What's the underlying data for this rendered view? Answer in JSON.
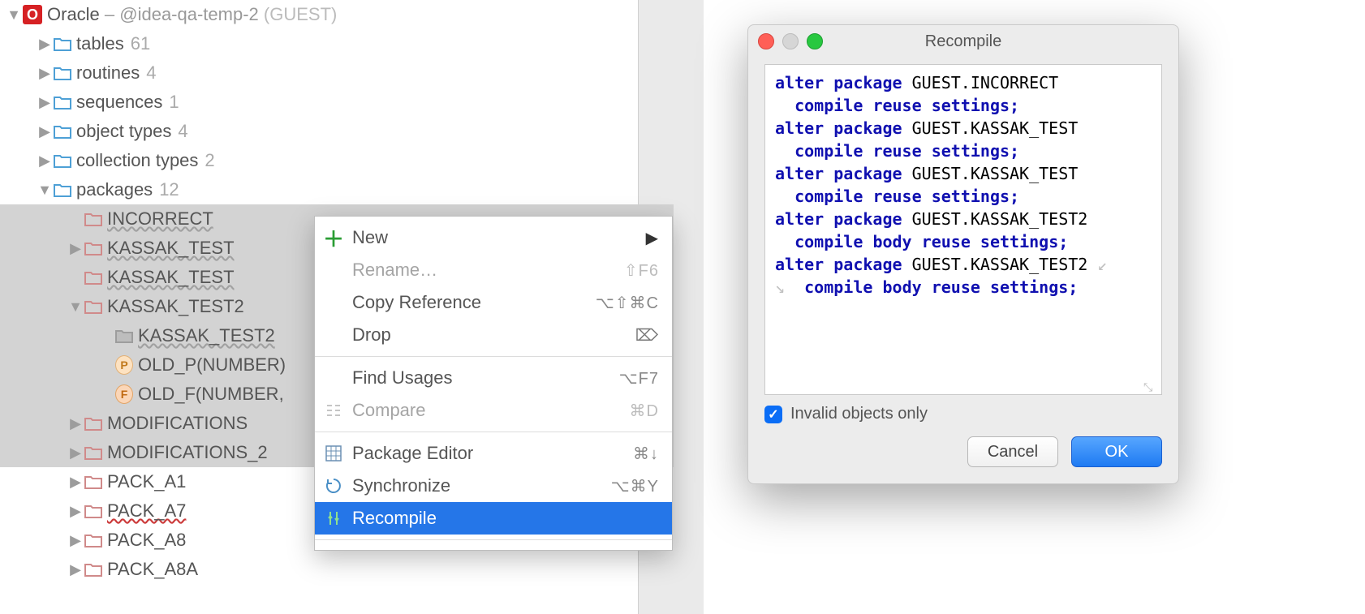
{
  "root": {
    "label": "Oracle",
    "suffix": " – @idea-qa-temp-2",
    "role": "(GUEST)"
  },
  "tree": {
    "tables": {
      "label": "tables",
      "count": "61"
    },
    "routines": {
      "label": "routines",
      "count": "4"
    },
    "sequences": {
      "label": "sequences",
      "count": "1"
    },
    "objtypes": {
      "label": "object types",
      "count": "4"
    },
    "colltypes": {
      "label": "collection types",
      "count": "2"
    },
    "packages": {
      "label": "packages",
      "count": "12"
    },
    "pkg": {
      "incorrect": "INCORRECT",
      "kassak_test": "KASSAK_TEST",
      "kassak_test_dup": "KASSAK_TEST",
      "kassak_test2": "KASSAK_TEST2",
      "kassak_test2_inner": "KASSAK_TEST2",
      "old_p": "OLD_P(NUMBER)",
      "old_f": "OLD_F(NUMBER,",
      "modifications": "MODIFICATIONS",
      "modifications2": "MODIFICATIONS_2",
      "pack_a1": "PACK_A1",
      "pack_a7": "PACK_A7",
      "pack_a8": "PACK_A8",
      "pack_a8a": "PACK_A8A"
    }
  },
  "menu": {
    "new": "New",
    "rename": "Rename…",
    "rename_sc": "⇧F6",
    "copyref": "Copy Reference",
    "copyref_sc": "⌥⇧⌘C",
    "drop": "Drop",
    "find": "Find Usages",
    "find_sc": "⌥F7",
    "compare": "Compare",
    "compare_sc": "⌘D",
    "pkgedit": "Package Editor",
    "pkgedit_sc": "⌘↓",
    "sync": "Synchronize",
    "sync_sc": "⌥⌘Y",
    "recompile": "Recompile"
  },
  "dialog": {
    "title": "Recompile",
    "checkbox": "Invalid objects only",
    "cancel": "Cancel",
    "ok": "OK",
    "sql": [
      {
        "pre": "alter package ",
        "obj": "GUEST.INCORRECT",
        "post": ""
      },
      {
        "pre": "  compile reuse settings",
        "obj": "",
        "post": ";"
      },
      {
        "pre": "alter package ",
        "obj": "GUEST.KASSAK_TEST",
        "post": ""
      },
      {
        "pre": "  compile reuse settings",
        "obj": "",
        "post": ";"
      },
      {
        "pre": "alter package ",
        "obj": "GUEST.KASSAK_TEST",
        "post": ""
      },
      {
        "pre": "  compile reuse settings",
        "obj": "",
        "post": ";"
      },
      {
        "pre": "alter package ",
        "obj": "GUEST.KASSAK_TEST2",
        "post": ""
      },
      {
        "pre": "  compile body reuse settings",
        "obj": "",
        "post": ";"
      },
      {
        "pre": "alter package ",
        "obj": "GUEST.KASSAK_TEST2",
        "post": ""
      },
      {
        "pre": "  compile body reuse settings",
        "obj": "",
        "post": ";"
      }
    ]
  }
}
